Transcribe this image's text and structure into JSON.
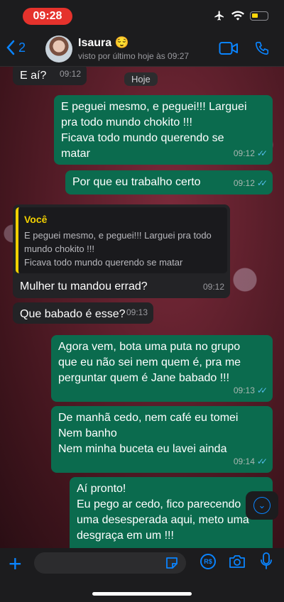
{
  "status_bar": {
    "time": "09:28"
  },
  "header": {
    "back_count": "2",
    "contact_name": "Isaura 😌",
    "last_seen": "visto por último hoje às 09:27"
  },
  "chat": {
    "date_label": "Hoje",
    "messages": [
      {
        "direction": "in",
        "text": "E aí?",
        "time": "09:12"
      },
      {
        "direction": "out",
        "text": "E peguei mesmo, e peguei!!! Larguei\npra todo mundo chokito !!!\nFicava todo mundo querendo se\nmatar",
        "time": "09:12",
        "read": true
      },
      {
        "direction": "out",
        "text": "Por que eu trabalho certo",
        "time": "09:12",
        "read": true
      },
      {
        "direction": "in",
        "quote_author": "Você",
        "quote_text": "E peguei mesmo, e peguei!!! Larguei pra todo\nmundo chokito !!!\nFicava todo mundo querendo se matar",
        "text": "Mulher tu mandou errad?",
        "time": "09:12"
      },
      {
        "direction": "in",
        "text": "Que babado é esse?",
        "time": "09:13"
      },
      {
        "direction": "out",
        "text": "Agora vem, bota uma puta no grupo\nque eu não sei nem quem é, pra me\nperguntar quem é Jane babado !!!",
        "time": "09:13",
        "read": true
      },
      {
        "direction": "out",
        "text": "De manhã cedo, nem café eu tomei\nNem banho\nNem minha buceta eu lavei ainda",
        "time": "09:14",
        "read": true
      },
      {
        "direction": "out",
        "text": "Aí pronto!\nEu pego ar cedo, fico parecendo\numa desesperada aqui, meto uma\ndesgraça em um !!!",
        "time": "",
        "read": false
      }
    ]
  },
  "colors": {
    "accent": "#0a84ff",
    "outgoing_bubble": "#0b6b4e",
    "incoming_bubble": "#232326",
    "quote_bar": "#f2d000",
    "read_check": "#53bdeb"
  },
  "icons": [
    "back-chevron-icon",
    "video-call-icon",
    "phone-icon",
    "plus-icon",
    "sticker-icon",
    "pix-rs-icon",
    "camera-icon",
    "microphone-icon",
    "scroll-down-icon",
    "airplane-icon",
    "wifi-icon",
    "battery-icon"
  ]
}
